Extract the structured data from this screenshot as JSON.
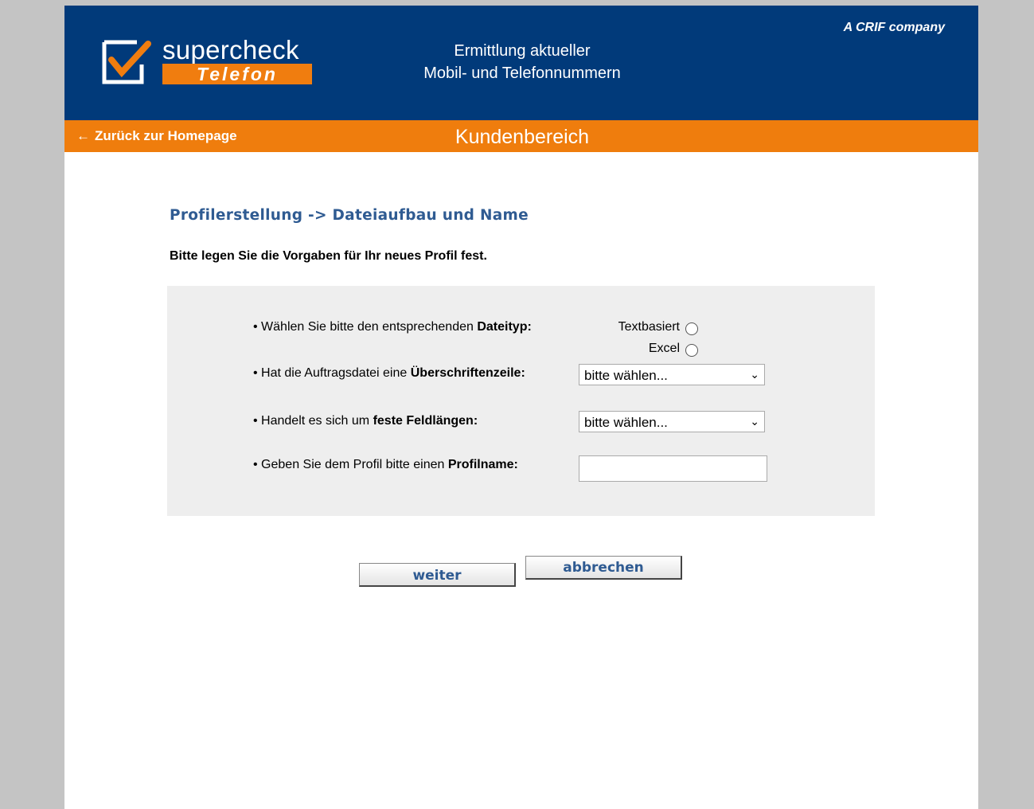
{
  "header": {
    "logo_top": "supercheck",
    "logo_bottom": "Telefon",
    "title_line1": "Ermittlung aktueller",
    "title_line2": "Mobil- und Telefonnummern",
    "crif": "A CRIF company"
  },
  "navbar": {
    "back_label": "Zurück zur Homepage",
    "title": "Kundenbereich"
  },
  "main": {
    "section_title": "Profilerstellung -> Dateiaufbau und Name",
    "intro": "Bitte legen Sie die Vorgaben für Ihr neues Profil fest."
  },
  "form": {
    "q1_prefix": "Wählen Sie bitte den entsprechenden ",
    "q1_bold": "Dateityp:",
    "radio1_label": "Textbasiert",
    "radio2_label": "Excel",
    "q2_prefix": "Hat die Auftragsdatei eine ",
    "q2_bold": "Überschriftenzeile:",
    "select1_value": "bitte wählen...",
    "q3_prefix": "Handelt es sich um ",
    "q3_bold": "feste Feldlängen:",
    "select2_value": "bitte wählen...",
    "q4_prefix": "Geben Sie dem Profil bitte einen ",
    "q4_bold": "Profilname:",
    "profilename_value": ""
  },
  "buttons": {
    "next": "weiter",
    "cancel": "abbrechen"
  },
  "colors": {
    "header_blue": "#013a7a",
    "orange": "#ef7d0d",
    "title_blue": "#2f5b92"
  }
}
